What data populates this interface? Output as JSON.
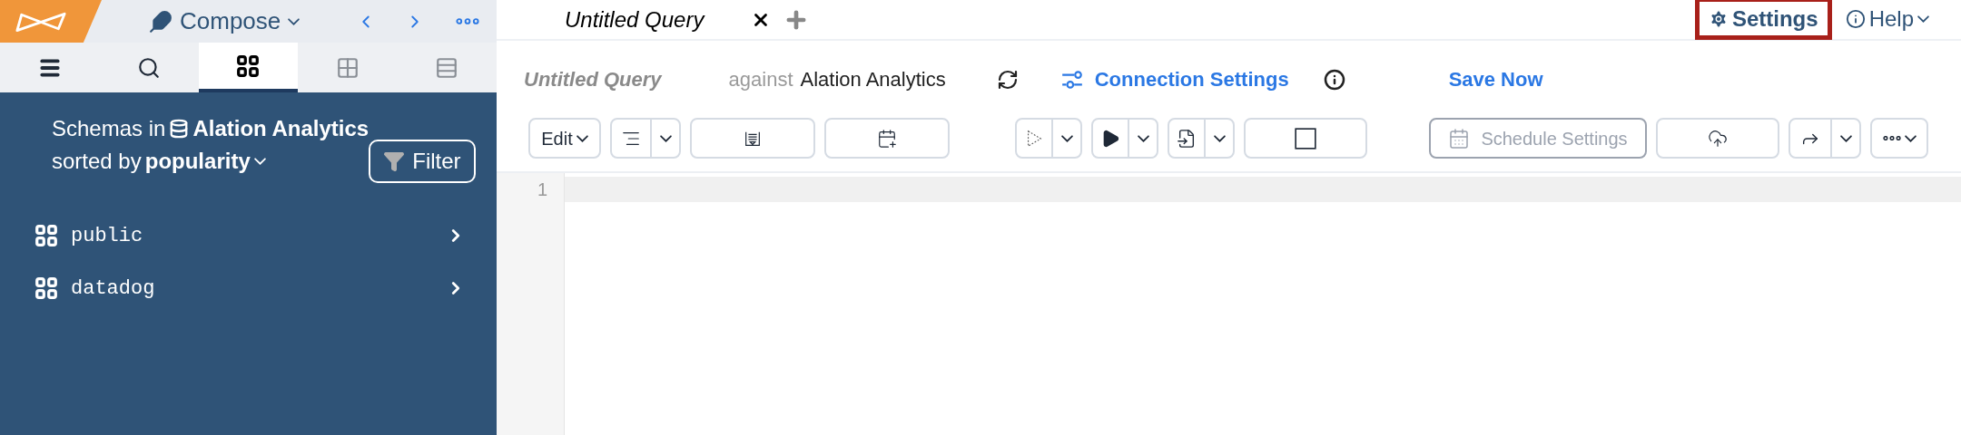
{
  "top_bar": {
    "mode": "Compose"
  },
  "sidebar_tabs": [
    {
      "selected": false
    },
    {
      "selected": false
    },
    {
      "selected": true
    },
    {
      "selected": false
    },
    {
      "selected": false
    }
  ],
  "schema_panel": {
    "heading_prefix": "Schemas in",
    "datasource": "Alation Analytics",
    "sort_prefix": "sorted by",
    "sort_value": "popularity",
    "filter_button": "Filter",
    "schemas": [
      {
        "name": "public"
      },
      {
        "name": "datadog"
      }
    ]
  },
  "tabs": [
    {
      "label": "Untitled Query",
      "selected": true
    }
  ],
  "top_links": [
    {
      "kind": "settings",
      "label": "Settings",
      "highlighted": true
    },
    {
      "kind": "help",
      "label": "Help",
      "highlighted": false
    }
  ],
  "query_header": {
    "title": "Untitled Query",
    "against": "against",
    "datasource": "Alation Analytics",
    "connection_settings": "Connection Settings",
    "save": "Save Now"
  },
  "toolbar": [
    {
      "kind": "dropdown",
      "label": "Edit",
      "disabled": false
    },
    {
      "kind": "split",
      "disabled": false
    },
    {
      "kind": "wide",
      "disabled": false
    },
    {
      "kind": "wide",
      "disabled": false
    },
    {
      "kind": "split",
      "disabled": false
    },
    {
      "kind": "split",
      "disabled": false
    },
    {
      "kind": "split",
      "disabled": false
    },
    {
      "kind": "wide",
      "disabled": false
    },
    {
      "kind": "labeled",
      "label": "Schedule Settings",
      "disabled": true
    },
    {
      "kind": "wide",
      "disabled": false
    },
    {
      "kind": "split",
      "disabled": false
    },
    {
      "kind": "dropdown",
      "disabled": false
    }
  ],
  "editor": {
    "line_numbers": [
      "1"
    ]
  }
}
